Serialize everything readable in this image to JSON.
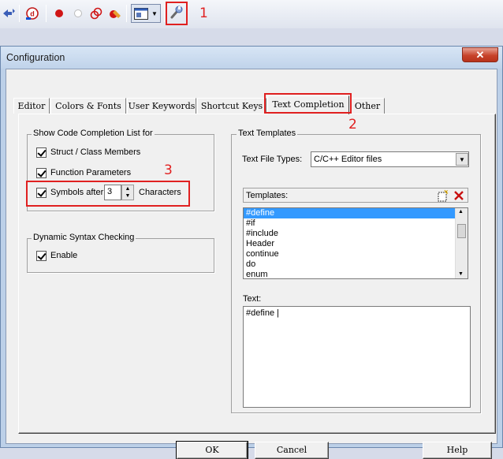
{
  "annotations": {
    "one": "1",
    "two": "2",
    "three": "3"
  },
  "toolbar": {
    "icons": [
      "back-forward-icon",
      "debug-icon",
      "breakpoint-icon",
      "disabled-breakpoint-icon",
      "kill-breakpoints-icon",
      "clear-breakpoints-icon",
      "window-layout-icon",
      "dropdown-icon",
      "configuration-wrench-icon"
    ]
  },
  "window": {
    "title": "Configuration",
    "close_glyph": "✕"
  },
  "tabs": [
    {
      "label": "Editor"
    },
    {
      "label": "Colors & Fonts"
    },
    {
      "label": "User Keywords"
    },
    {
      "label": "Shortcut Keys"
    },
    {
      "label": "Text Completion"
    },
    {
      "label": "Other"
    }
  ],
  "active_tab": "Text Completion",
  "code_completion": {
    "group_title": "Show Code Completion List for",
    "struct_members": {
      "label": "Struct / Class Members",
      "checked": true
    },
    "function_params": {
      "label": "Function Parameters",
      "checked": true
    },
    "symbols_after": {
      "label": "Symbols after",
      "checked": true,
      "value": "3",
      "suffix": "Characters"
    }
  },
  "syntax_checking": {
    "group_title": "Dynamic Syntax Checking",
    "enable": {
      "label": "Enable",
      "checked": true
    }
  },
  "text_templates": {
    "group_title": "Text Templates",
    "file_types_label": "Text File Types:",
    "file_types_value": "C/C++ Editor files",
    "templates_label": "Templates:",
    "templates": [
      "#define",
      "#if",
      "#include",
      "Header",
      "continue",
      "do",
      "enum"
    ],
    "selected_template": "#define",
    "text_label": "Text:",
    "text_value": "#define |"
  },
  "buttons": {
    "ok": "OK",
    "cancel": "Cancel",
    "help": "Help"
  },
  "colors": {
    "accent_red": "#e02020",
    "selection": "#3399ff"
  }
}
